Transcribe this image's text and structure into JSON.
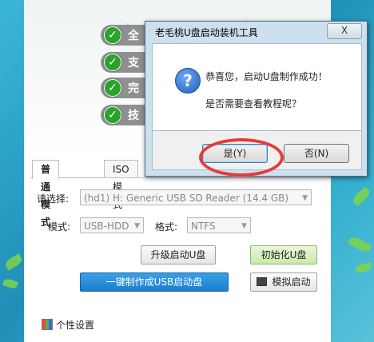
{
  "features": [
    "全",
    "支",
    "完",
    "技"
  ],
  "tabs": [
    "普通模式",
    "ISO模式"
  ],
  "select_label": "请选择:",
  "select_value": "(hd1) H: Generic USB  SD Reader (14.4 GB)",
  "mode_label": "模式:",
  "mode_value": "USB-HDD",
  "format_label": "格式:",
  "format_value": "NTFS",
  "buttons": {
    "upgrade": "升级启动U盘",
    "init": "初始化U盘",
    "make": "一键制作成USB启动盘",
    "simulate": "模拟启动"
  },
  "personal": "个性设置",
  "dialog": {
    "title": "老毛桃U盘启动装机工具",
    "close": "X",
    "line1": "恭喜您，启动U盘制作成功！",
    "line2": "是否需要查看教程呢？",
    "yes": "是(Y)",
    "no": "否(N)"
  },
  "colors": {
    "annotation": "#e53b3b",
    "check": "#2aa32a",
    "primary_button": "#1a7fcc"
  }
}
